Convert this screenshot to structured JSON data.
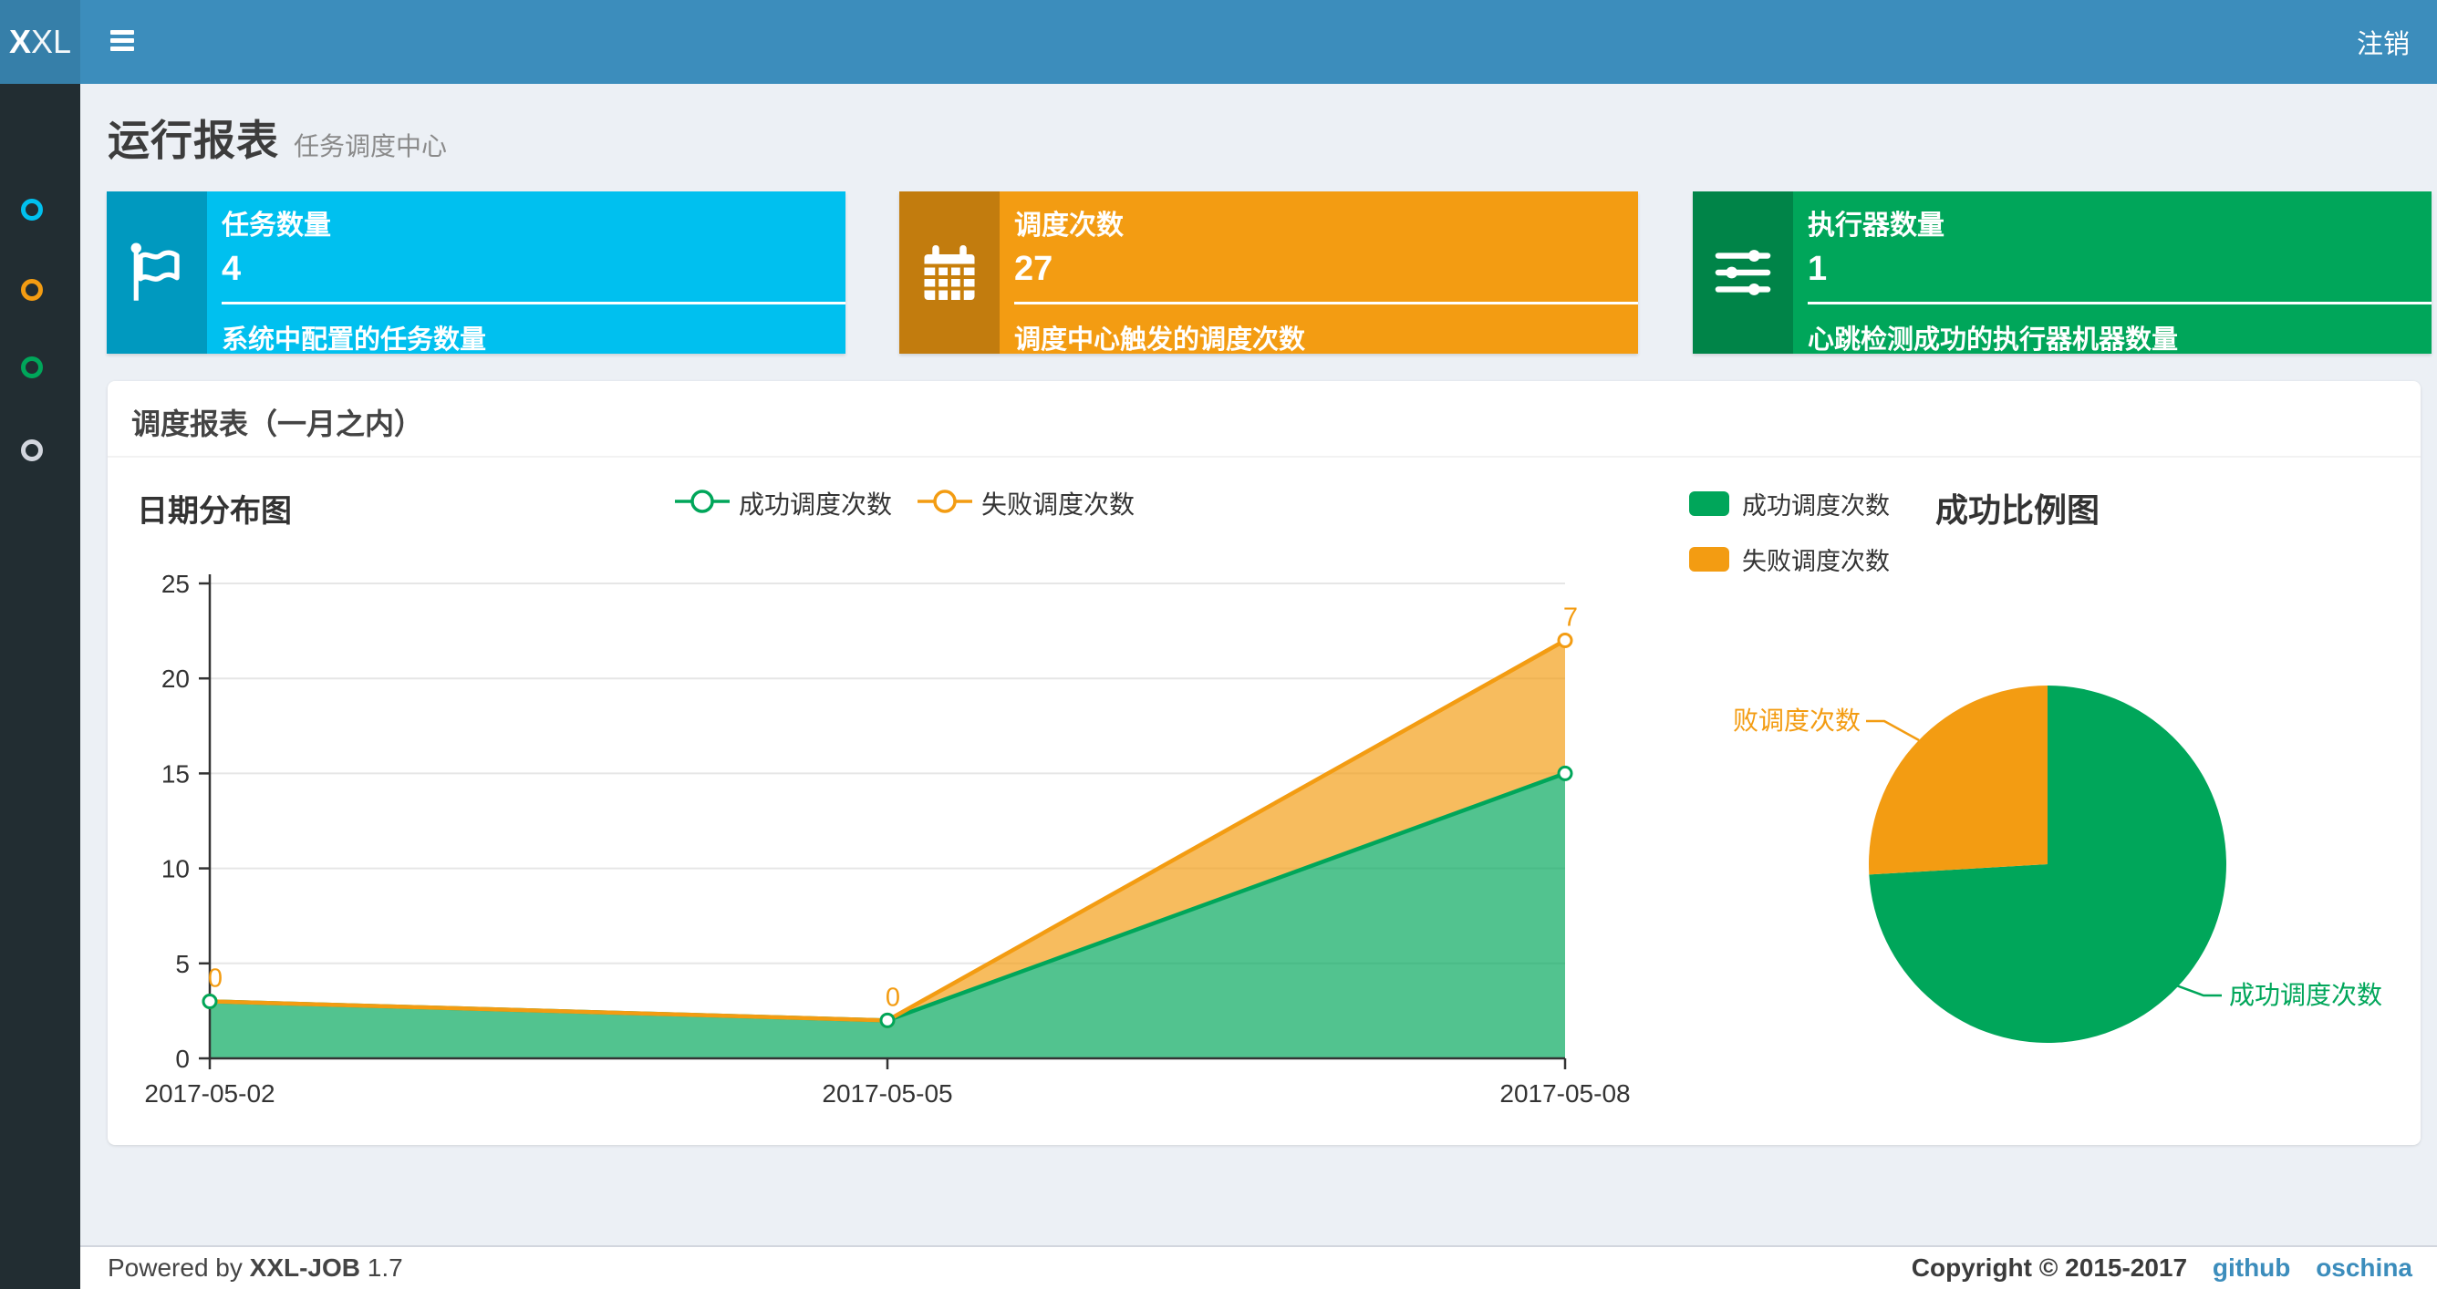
{
  "topbar": {
    "logo_bold": "X",
    "logo_rest": "XL",
    "logout_label": "注销"
  },
  "sidebar": {
    "items": [
      {
        "name": "menu-item-1",
        "color": "#00c0ef"
      },
      {
        "name": "menu-item-2",
        "color": "#f39c12"
      },
      {
        "name": "menu-item-3",
        "color": "#00a65a"
      },
      {
        "name": "menu-item-4",
        "color": "#d2d6de"
      }
    ]
  },
  "page_header": {
    "title": "运行报表",
    "subtitle": "任务调度中心"
  },
  "stat_boxes": [
    {
      "title": "任务数量",
      "value": "4",
      "description": "系统中配置的任务数量",
      "color": "#00c0ef",
      "icon": "flag-icon"
    },
    {
      "title": "调度次数",
      "value": "27",
      "description": "调度中心触发的调度次数",
      "color": "#f39c12",
      "icon": "calendar-icon"
    },
    {
      "title": "执行器数量",
      "value": "1",
      "description": "心跳检测成功的执行器机器数量",
      "color": "#00a65a",
      "icon": "sliders-icon"
    }
  ],
  "panel": {
    "title": "调度报表（一月之内）"
  },
  "chart_data": [
    {
      "type": "area",
      "title": "日期分布图",
      "x": [
        "2017-05-02",
        "2017-05-05",
        "2017-05-08"
      ],
      "series": [
        {
          "name": "成功调度次数",
          "values": [
            3,
            2,
            15
          ],
          "color": "#00A65A"
        },
        {
          "name": "失败调度次数",
          "values": [
            0,
            0,
            7
          ],
          "color": "#F39C12",
          "labels": [
            "0",
            "0",
            "7"
          ]
        }
      ],
      "stacked": true,
      "ylim": [
        0,
        25
      ],
      "yticks": [
        0,
        5,
        10,
        15,
        20,
        25
      ],
      "grid": true,
      "legend_position": "top-center"
    },
    {
      "type": "pie",
      "title": "成功比例图",
      "slices": [
        {
          "label": "成功调度次数",
          "value": 20,
          "color": "#00A65A"
        },
        {
          "label": "失败调度次数",
          "value": 7,
          "color": "#F39C12"
        }
      ],
      "legend_position": "top-left"
    }
  ],
  "footer": {
    "powered_prefix": "Powered by",
    "product": "XXL-JOB",
    "version": "1.7",
    "copyright": "Copyright © 2015-2017",
    "links": [
      {
        "label": "github"
      },
      {
        "label": "oschina"
      }
    ]
  },
  "colors": {
    "topbar": "#3c8dbc",
    "logo_bg": "#367fa9",
    "sidebar": "#222d32",
    "content_bg": "#ecf0f5",
    "success": "#00A65A",
    "fail": "#F39C12",
    "info": "#00c0ef",
    "link": "#3c8dbc"
  }
}
